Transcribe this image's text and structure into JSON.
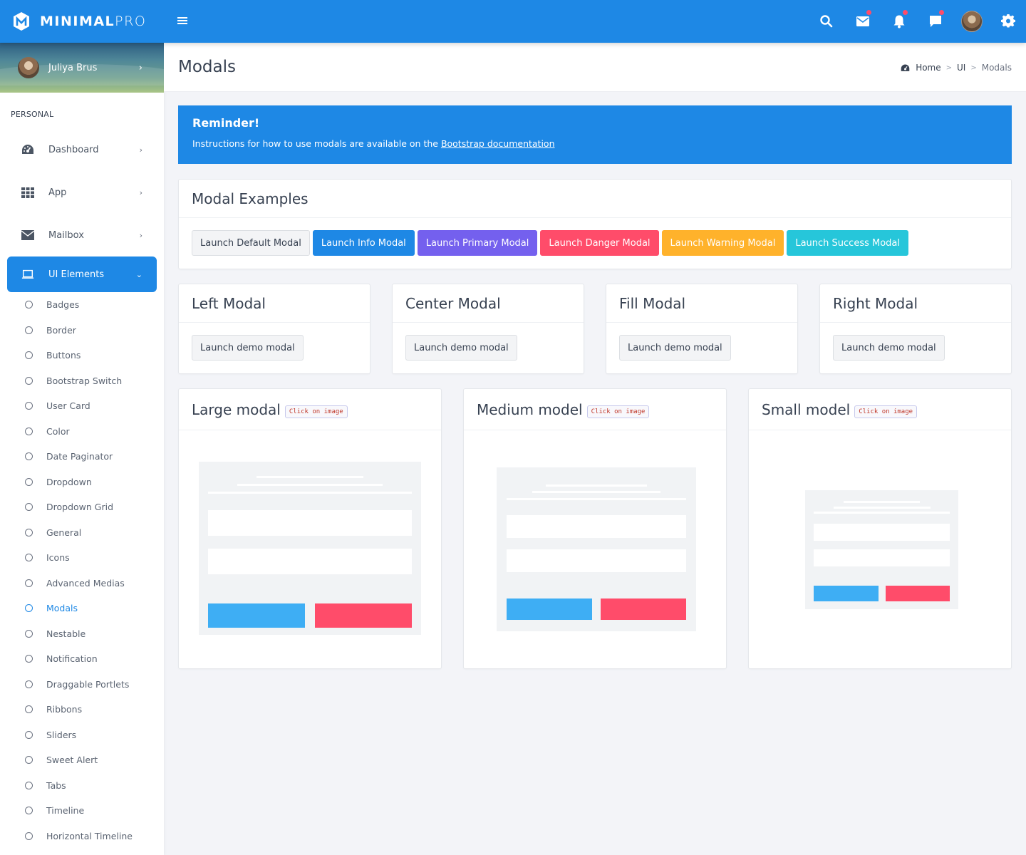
{
  "brand": {
    "name_bold": "MINIMAL",
    "name_light": "PRO"
  },
  "topbar": {
    "icons": [
      {
        "name": "search-icon",
        "badge": false
      },
      {
        "name": "mail-icon",
        "badge": true
      },
      {
        "name": "bell-icon",
        "badge": true
      },
      {
        "name": "chat-icon",
        "badge": true
      },
      {
        "name": "user-avatar",
        "badge": false
      },
      {
        "name": "gear-icon",
        "badge": false
      }
    ]
  },
  "sidebar": {
    "user_name": "Juliya Brus",
    "section_label": "PERSONAL",
    "items": [
      {
        "label": "Dashboard",
        "icon": "dashboard-icon"
      },
      {
        "label": "App",
        "icon": "grid-icon"
      },
      {
        "label": "Mailbox",
        "icon": "envelope-icon"
      },
      {
        "label": "UI Elements",
        "icon": "laptop-icon",
        "active": true
      }
    ],
    "sub_items": [
      "Badges",
      "Border",
      "Buttons",
      "Bootstrap Switch",
      "User Card",
      "Color",
      "Date Paginator",
      "Dropdown",
      "Dropdown Grid",
      "General",
      "Icons",
      "Advanced Medias",
      "Modals",
      "Nestable",
      "Notification",
      "Draggable Portlets",
      "Ribbons",
      "Sliders",
      "Sweet Alert",
      "Tabs",
      "Timeline",
      "Horizontal Timeline"
    ],
    "active_sub_item": "Modals"
  },
  "header": {
    "title": "Modals",
    "breadcrumb": [
      "Home",
      "UI",
      "Modals"
    ]
  },
  "callout": {
    "title": "Reminder!",
    "text": "Instructions for how to use modals are available on the ",
    "link": "Bootstrap documentation"
  },
  "examples": {
    "title": "Modal Examples",
    "buttons": [
      {
        "label": "Launch Default Modal",
        "variant": "default",
        "color": "#f3f4f6"
      },
      {
        "label": "Launch Info Modal",
        "variant": "info",
        "color": "#1e88e5"
      },
      {
        "label": "Launch Primary Modal",
        "variant": "primary",
        "color": "#7460ee"
      },
      {
        "label": "Launch Danger Modal",
        "variant": "danger",
        "color": "#ff4c6a"
      },
      {
        "label": "Launch Warning Modal",
        "variant": "warning",
        "color": "#ffb22b"
      },
      {
        "label": "Launch Success Modal",
        "variant": "success",
        "color": "#26c6da"
      }
    ]
  },
  "position_cards": [
    {
      "title": "Left Modal",
      "button": "Launch demo modal"
    },
    {
      "title": "Center Modal",
      "button": "Launch demo modal"
    },
    {
      "title": "Fill Modal",
      "button": "Launch demo modal"
    },
    {
      "title": "Right Modal",
      "button": "Launch demo modal"
    }
  ],
  "size_cards": [
    {
      "title": "Large modal",
      "badge": "Click on image",
      "size": "large"
    },
    {
      "title": "Medium model",
      "badge": "Click on image",
      "size": "medium"
    },
    {
      "title": "Small model",
      "badge": "Click on image",
      "size": "small"
    }
  ],
  "colors": {
    "accent": "#1e88e5",
    "preview_confirm": "#3eaef4",
    "preview_cancel": "#ff4c6a"
  }
}
